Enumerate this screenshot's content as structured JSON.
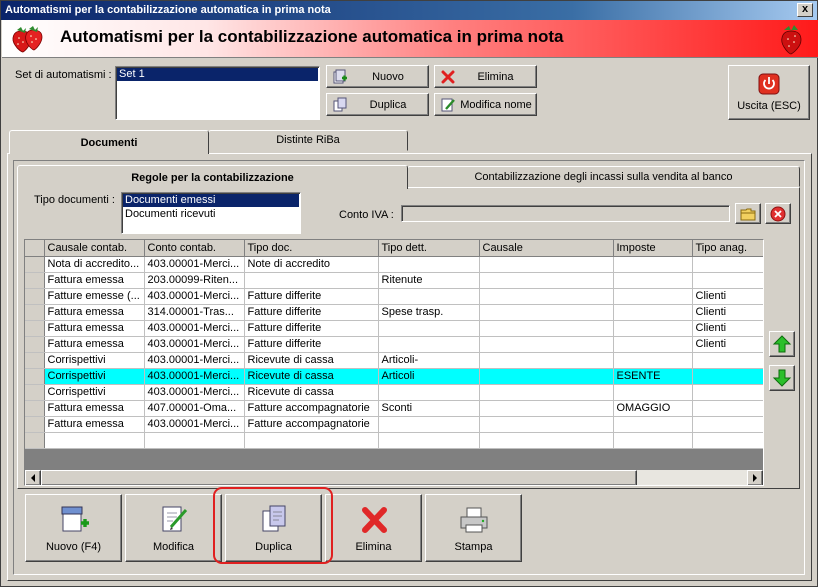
{
  "window": {
    "title": "Automatismi per la contabilizzazione automatica in prima nota",
    "close_glyph": "x"
  },
  "banner": {
    "title": "Automatismi per la contabilizzazione automatica in prima nota"
  },
  "set": {
    "label": "Set di automatismi :",
    "items": [
      "Set 1"
    ],
    "selected": 0
  },
  "toolbar": {
    "nuovo": "Nuovo",
    "elimina": "Elimina",
    "duplica": "Duplica",
    "modifica_nome": "Modifica nome",
    "uscita": "Uscita (ESC)"
  },
  "main_tabs": [
    "Documenti",
    "Distinte RiBa"
  ],
  "sub_tabs": [
    "Regole per la contabilizzazione",
    "Contabilizzazione degli incassi sulla vendita al banco"
  ],
  "tipo_documenti": {
    "label": "Tipo documenti :",
    "items": [
      "Documenti emessi",
      "Documenti ricevuti"
    ],
    "selected": 0
  },
  "conto_iva": {
    "label": "Conto IVA :",
    "value": ""
  },
  "grid": {
    "columns": [
      "Causale contab.",
      "Conto contab.",
      "Tipo doc.",
      "Tipo dett.",
      "Causale",
      "Imposte",
      "Tipo anag."
    ],
    "rows": [
      [
        "Nota di accredito...",
        "403.00001-Merci...",
        "Note di accredito",
        "",
        "",
        "",
        ""
      ],
      [
        "Fattura emessa",
        "203.00099-Riten...",
        "",
        "Ritenute",
        "",
        "",
        ""
      ],
      [
        "Fatture emesse (...",
        "403.00001-Merci...",
        "Fatture differite",
        "",
        "",
        "",
        "Clienti"
      ],
      [
        "Fattura emessa",
        "314.00001-Tras...",
        "Fatture differite",
        "Spese trasp.",
        "",
        "",
        "Clienti"
      ],
      [
        "Fattura emessa",
        "403.00001-Merci...",
        "Fatture differite",
        "",
        "",
        "",
        "Clienti"
      ],
      [
        "Fattura emessa",
        "403.00001-Merci...",
        "Fatture differite",
        "",
        "",
        "",
        "Clienti"
      ],
      [
        "Corrispettivi",
        "403.00001-Merci...",
        "Ricevute di cassa",
        "Articoli-",
        "",
        "",
        ""
      ],
      [
        "Corrispettivi",
        "403.00001-Merci...",
        "Ricevute di cassa",
        "Articoli",
        "",
        "ESENTE",
        ""
      ],
      [
        "Corrispettivi",
        "403.00001-Merci...",
        "Ricevute di cassa",
        "",
        "",
        "",
        ""
      ],
      [
        "Fattura emessa",
        "407.00001-Oma...",
        "Fatture accompagnatorie",
        "Sconti",
        "",
        "OMAGGIO",
        ""
      ],
      [
        "Fattura emessa",
        "403.00001-Merci...",
        "Fatture accompagnatorie",
        "",
        "",
        "",
        ""
      ],
      [
        "",
        "",
        "",
        "",
        "",
        "",
        ""
      ]
    ],
    "selected_row": 7
  },
  "bottom_buttons": {
    "nuovo": "Nuovo (F4)",
    "modifica": "Modifica",
    "duplica": "Duplica",
    "elimina": "Elimina",
    "stampa": "Stampa"
  },
  "icons": {
    "logo": "strawberry-icon",
    "up": "arrow-up-icon",
    "down": "arrow-down-icon",
    "folder": "folder-icon",
    "clear": "clear-icon"
  },
  "colors": {
    "selected_row": "#00ffff",
    "highlight_ring": "#e02020",
    "list_selection": "#0a246a",
    "arrow_green": "#22aa22"
  }
}
